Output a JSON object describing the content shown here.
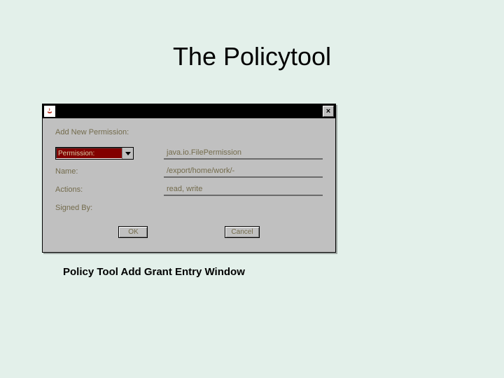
{
  "slide": {
    "title": "The Policytool",
    "caption": "Policy Tool Add Grant Entry Window"
  },
  "window": {
    "heading": "Add New Permission:",
    "rows": {
      "permission": {
        "select_label": "Permission:",
        "value": "java.io.FilePermission"
      },
      "name": {
        "label": "Name:",
        "value": "/export/home/work/-"
      },
      "actions": {
        "label": "Actions:",
        "value": "read, write"
      },
      "signed_by": {
        "label": "Signed By:",
        "value": ""
      }
    },
    "buttons": {
      "ok": "OK",
      "cancel": "Cancel"
    }
  }
}
